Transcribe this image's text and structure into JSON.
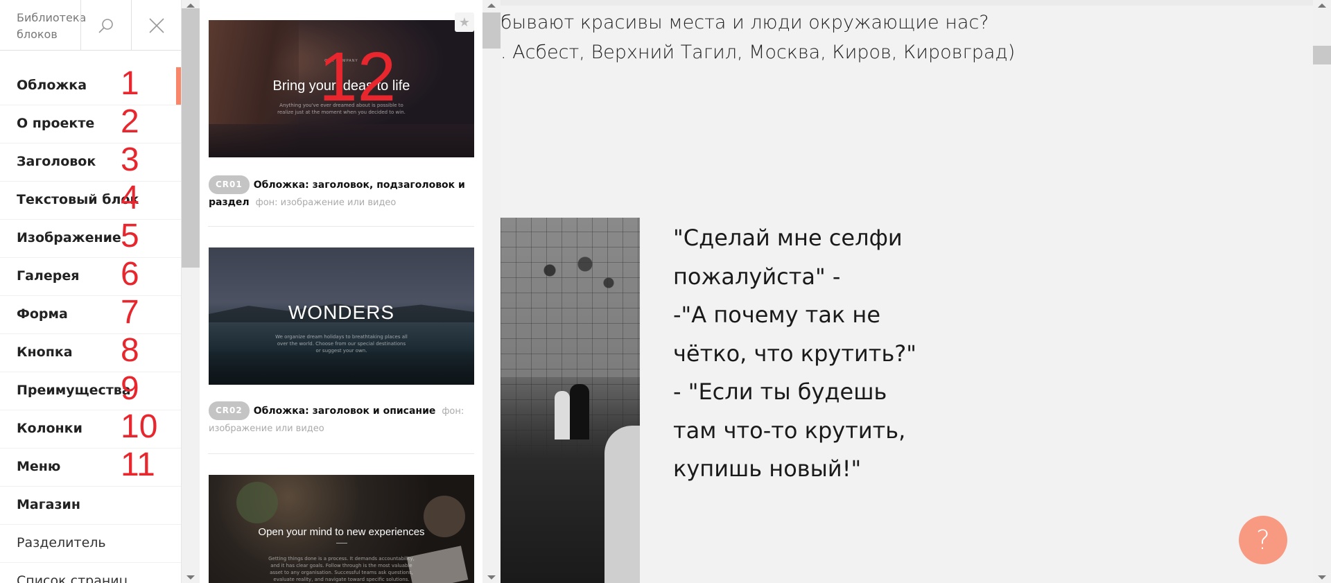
{
  "sidebar": {
    "title": "Библиотека блоков",
    "categories": [
      {
        "label": "Обложка",
        "num": "1"
      },
      {
        "label": "О проекте",
        "num": "2"
      },
      {
        "label": "Заголовок",
        "num": "3"
      },
      {
        "label": "Текстовый блок",
        "num": "4"
      },
      {
        "label": "Изображение",
        "num": "5"
      },
      {
        "label": "Галерея",
        "num": "6"
      },
      {
        "label": "Форма",
        "num": "7"
      },
      {
        "label": "Кнопка",
        "num": "8"
      },
      {
        "label": "Преимущества",
        "num": "9"
      },
      {
        "label": "Колонки",
        "num": "10"
      },
      {
        "label": "Меню",
        "num": "11"
      },
      {
        "label": "Магазин"
      },
      {
        "label": "Разделитель"
      },
      {
        "label": "Список страниц"
      }
    ],
    "active_category": "Обложка"
  },
  "blocks": {
    "annotation": "12",
    "items": [
      {
        "badge": "CR01",
        "name": "Обложка: заголовок, подзаголовок и раздел",
        "bg": "фон: изображение или видео",
        "thumb_kicker": "OUR COMPANY",
        "thumb_title": "Bring your ideas to life",
        "thumb_sub": "Anything you've ever dreamed about is possible to realize just at the moment when you decided to win."
      },
      {
        "badge": "CR02",
        "name": "Обложка: заголовок и описание",
        "bg": "фон: изображение или видео",
        "thumb_title": "WONDERS",
        "thumb_sub": "We organize dream holidays to breathtaking places all over the world. Choose from our special destinations or suggest your own."
      },
      {
        "thumb_title": "Open your mind to new experiences",
        "thumb_sub": "Getting things done is a process. It demands accountability, and it has clear goals. Follow through is the most valuable asset to any organisation. Successful teams ask questions, evaluate reality, and navigate toward specific solutions."
      }
    ]
  },
  "page": {
    "line1": "бывают красивы места и люди окружающие нас?",
    "line2": ". Асбест, Верхний Тагил, Москва, Киров, Кировград)",
    "quote_lines": [
      "\"Сделай мне селфи",
      "пожалуйста\" -",
      "-\"А почему так не",
      "чётко, что крутить?\"",
      "- \"Если ты будешь",
      "там что-то крутить,",
      "купишь новый!\""
    ]
  },
  "help": {
    "label": "?"
  },
  "colors": {
    "accent": "#fa8669",
    "annotation": "#e8262d",
    "help": "#f89a82"
  }
}
